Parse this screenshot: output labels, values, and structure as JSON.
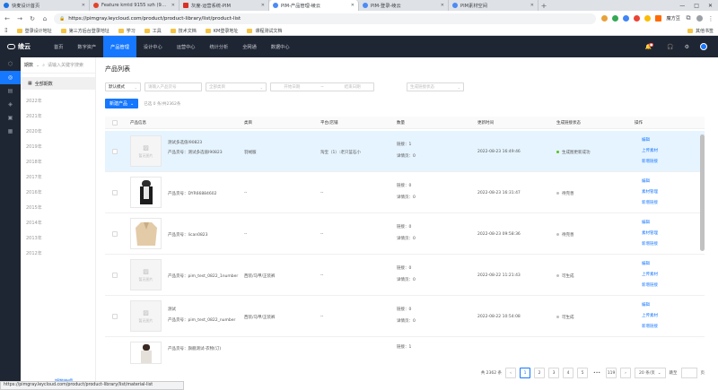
{
  "browser": {
    "tabs": [
      {
        "title": "快麦设计首页",
        "color": "#1a73e8",
        "active": false
      },
      {
        "title": "Feature kmtd 9155 szh (9514)",
        "color": "#e2432a",
        "active": false
      },
      {
        "title": "灰度-运营系统-PIM",
        "color": "#d93025",
        "active": false
      },
      {
        "title": "PIM-产品管理-绫云",
        "color": "#4c8bf5",
        "active": true
      },
      {
        "title": "PIM-登录-绫云",
        "color": "#4c8bf5",
        "active": false
      },
      {
        "title": "PIM素材空间",
        "color": "#4c8bf5",
        "active": false
      }
    ],
    "url": "https://pimgray.leycloud.com/product/product-library/list/product-list",
    "mofang": "魔方豆",
    "bookmarks": [
      "登录设计地址",
      "第三方后台登录地址",
      "学习",
      "工具",
      "技术文档",
      "KM登录地址",
      "课程测试文档"
    ],
    "other_bookmarks": "其他书签",
    "status_url": "https://pimgray.leycloud.com/product/product-library/list/material-list"
  },
  "header": {
    "logo": "绫云",
    "nav": [
      "首页",
      "数字资产",
      "产品管理",
      "设计中心",
      "运营中心",
      "统计分析",
      "全网通",
      "数据中心"
    ],
    "active_nav": "产品管理"
  },
  "periods": {
    "select": "期数",
    "placeholder": "请输入关键字搜索",
    "all": "全部期数",
    "years": [
      "2022年",
      "2021年",
      "2020年",
      "2019年",
      "2018年",
      "2017年",
      "2016年",
      "2015年",
      "2014年",
      "2013年",
      "2012年"
    ],
    "footer": "期数管理"
  },
  "main": {
    "title": "产品列表",
    "filters": {
      "sort": "默认模式",
      "name_ph": "请输入产品货号",
      "category_ph": "全部类目",
      "start_ph": "开始日期",
      "range_sep": "~",
      "end_ph": "结束日期",
      "status_ph": "生成链接状态"
    },
    "new_button": "新建产品",
    "selection": "已选 0 条/共2362条",
    "columns": [
      "产品信息",
      "类目",
      "平台/店铺",
      "数量",
      "更新时间",
      "生成链接状态",
      "操作"
    ],
    "rows": [
      {
        "thumb": "暂无图片",
        "name": "测试多选值I90823",
        "code": "产品货号：测试多选值I90823",
        "category": "羽绒服",
        "platform": "淘宝（1）:老只蓝石小",
        "links": "链接：1",
        "details": "详情页：0",
        "updated": "2022-08-23 16:49:46",
        "status": "生成图更新成功",
        "status_color": "#52c41a",
        "ops": [
          "编辑",
          "上传素材",
          "新增链接"
        ]
      },
      {
        "thumb": "",
        "name": "",
        "code": "产品货号：DYR66884602",
        "category": "--",
        "platform": "--",
        "links": "链接：0",
        "details": "详情页：0",
        "updated": "2022-08-23 16:31:47",
        "status": "待完善",
        "status_color": "#bfbfbf",
        "ops": [
          "编辑",
          "素材管理",
          "新增链接"
        ]
      },
      {
        "thumb": "",
        "name": "",
        "code": "产品货号：lican0823",
        "category": "--",
        "platform": "--",
        "links": "链接：0",
        "details": "详情页：0",
        "updated": "2022-08-23 09:58:36",
        "status": "待完善",
        "status_color": "#bfbfbf",
        "ops": [
          "编辑",
          "素材管理",
          "新增链接"
        ]
      },
      {
        "thumb": "暂无图片",
        "name": "",
        "code": "产品货号：pim_test_0822_1number",
        "category": "西装/马甲/正装裤",
        "platform": "--",
        "links": "链接：0",
        "details": "详情页：0",
        "updated": "2022-08-22 11:21:43",
        "status": "可生成",
        "status_color": "#bfbfbf",
        "ops": [
          "编辑",
          "上传素材",
          "新增链接"
        ]
      },
      {
        "thumb": "暂无图片",
        "name": "测试",
        "code": "产品货号：pim_test_0822_number",
        "category": "西装/马甲/正装裤",
        "platform": "--",
        "links": "链接：0",
        "details": "详情页：0",
        "updated": "2022-08-22 10:54:08",
        "status": "可生成",
        "status_color": "#bfbfbf",
        "ops": [
          "编辑",
          "上传素材",
          "新增链接"
        ]
      },
      {
        "thumb": "",
        "name": "",
        "code": "产品货号：旗舰测试-衣物(订)",
        "category": "",
        "platform": "",
        "links": "链接：1",
        "details": "",
        "updated": "",
        "status": "",
        "status_color": "#bfbfbf",
        "ops": []
      }
    ],
    "pager": {
      "total": "共 2362 条",
      "prev": "‹",
      "pages": [
        "1",
        "2",
        "3",
        "4",
        "5"
      ],
      "ellipsis": "•••",
      "last": "119",
      "next": "›",
      "size": "20 条/页",
      "jump": "跳至",
      "page_unit": "页",
      "current": 1
    }
  }
}
